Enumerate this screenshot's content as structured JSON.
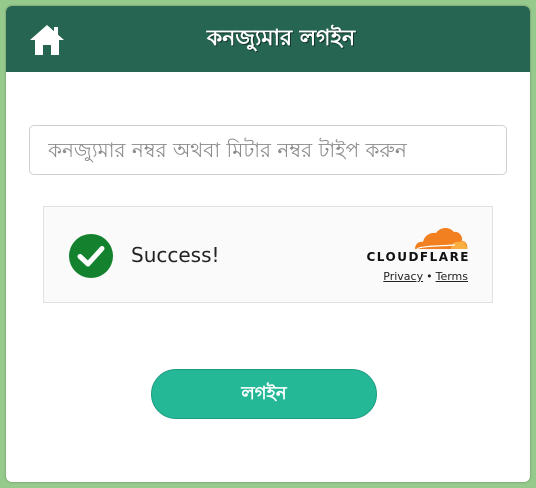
{
  "header": {
    "title": "কনজ্যুমার লগইন",
    "home_icon": "home-icon",
    "background_color": "#256551"
  },
  "login_form": {
    "consumer_number_placeholder": "কনজ্যুমার নম্বর অথবা মিটার নম্বর টাইপ করুন",
    "consumer_number_value": ""
  },
  "captcha": {
    "status_icon": "check-circle-icon",
    "status_text": "Success!",
    "brand": "CLOUDFLARE",
    "privacy_link": "Privacy",
    "separator": "•",
    "terms_link": "Terms",
    "status_color": "#14812f",
    "brand_color": "#f38020"
  },
  "login_button": {
    "label": "লগইন",
    "color": "#24b896"
  }
}
